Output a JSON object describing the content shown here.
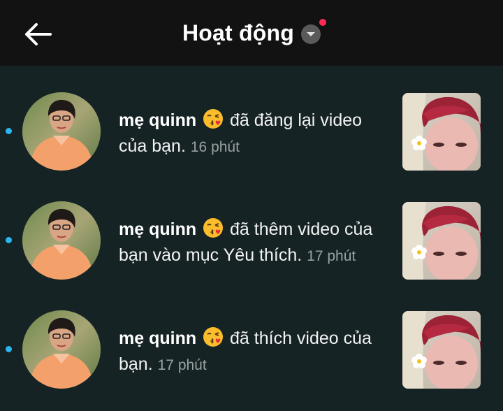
{
  "header": {
    "title": "Hoạt động",
    "back_icon": "arrow-left-icon",
    "dropdown_icon": "chevron-down-icon",
    "notification_dot_color": "#fe2c55"
  },
  "activities": [
    {
      "user": "mẹ quinn",
      "emoji": "face-blowing-kiss",
      "text": "đã đăng lại video của bạn.",
      "time": "16 phút",
      "unread": true
    },
    {
      "user": "mẹ quinn",
      "emoji": "face-blowing-kiss",
      "text": "đã thêm video của bạn vào mục Yêu thích.",
      "time": "17 phút",
      "unread": true
    },
    {
      "user": "mẹ quinn",
      "emoji": "face-blowing-kiss",
      "text": "đã thích video của bạn.",
      "time": "17 phút",
      "unread": true
    }
  ],
  "colors": {
    "background": "#162325",
    "header": "#121212",
    "unread": "#2ab6f2"
  }
}
